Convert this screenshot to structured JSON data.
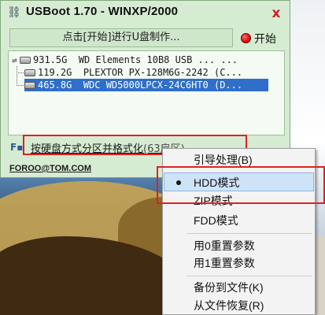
{
  "window": {
    "title": "USBoot 1.70 - WINXP/2000",
    "close_label": "x",
    "hint": "点击[开始]进行U盘制作...",
    "start_label": "开始"
  },
  "drives": [
    {
      "size": "931.5G",
      "name": "WD Elements 10B8 USB ... ...",
      "selected": false
    },
    {
      "size": "119.2G",
      "name": "PLEXTOR PX-128M6G-2242 (C...",
      "selected": false
    },
    {
      "size": "465.8G",
      "name": "WDC WD5000LPCX-24C6HT0 (D...",
      "selected": true
    }
  ],
  "mode_link": {
    "main": "按硬盘方式分区并格式化",
    "suffix": "(63扇区)"
  },
  "email": "FOROO@TOM.COM",
  "menu": {
    "items": [
      {
        "label": "引导处理(B)"
      },
      {
        "label": "HDD模式",
        "checked": true
      },
      {
        "label": "ZIP模式"
      },
      {
        "label": "FDD模式"
      },
      {
        "label": "用0重置参数"
      },
      {
        "label": "用1重置参数"
      },
      {
        "label": "备份到文件(K)"
      },
      {
        "label": "从文件恢复(R)"
      }
    ]
  },
  "colors": {
    "window_bg": "#d6ecd2",
    "selection": "#2f6fc9",
    "highlight_box": "#e02020"
  }
}
